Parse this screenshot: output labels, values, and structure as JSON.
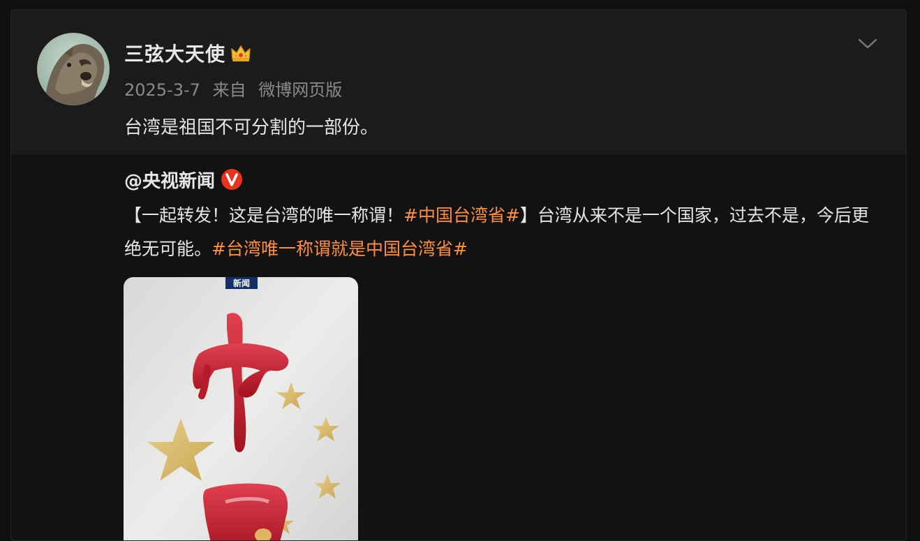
{
  "post": {
    "username": "三弦大天使",
    "date": "2025-3-7",
    "source_prefix": "来自",
    "source": "微博网页版",
    "text": "台湾是祖国不可分割的一部份。"
  },
  "repost": {
    "author": "@央视新闻",
    "text_part1": "【一起转发！这是台湾的唯一称谓！",
    "hashtag1": "#中国台湾省#",
    "text_part2": "】台湾从来不是一个国家，过去不是，今后更绝无可能。",
    "hashtag2": "#台湾唯一称谓就是中国台湾省#",
    "image_tag": "新闻",
    "image_calligraphy": "中国"
  },
  "colors": {
    "hashtag": "#ff8f3e",
    "verified_badge": "#e8341c",
    "card_bg": "#1b1b1b",
    "repost_bg": "#121212"
  },
  "icons": {
    "crown": "crown-icon",
    "verified": "verified-v-icon",
    "menu": "chevron-down-icon"
  }
}
